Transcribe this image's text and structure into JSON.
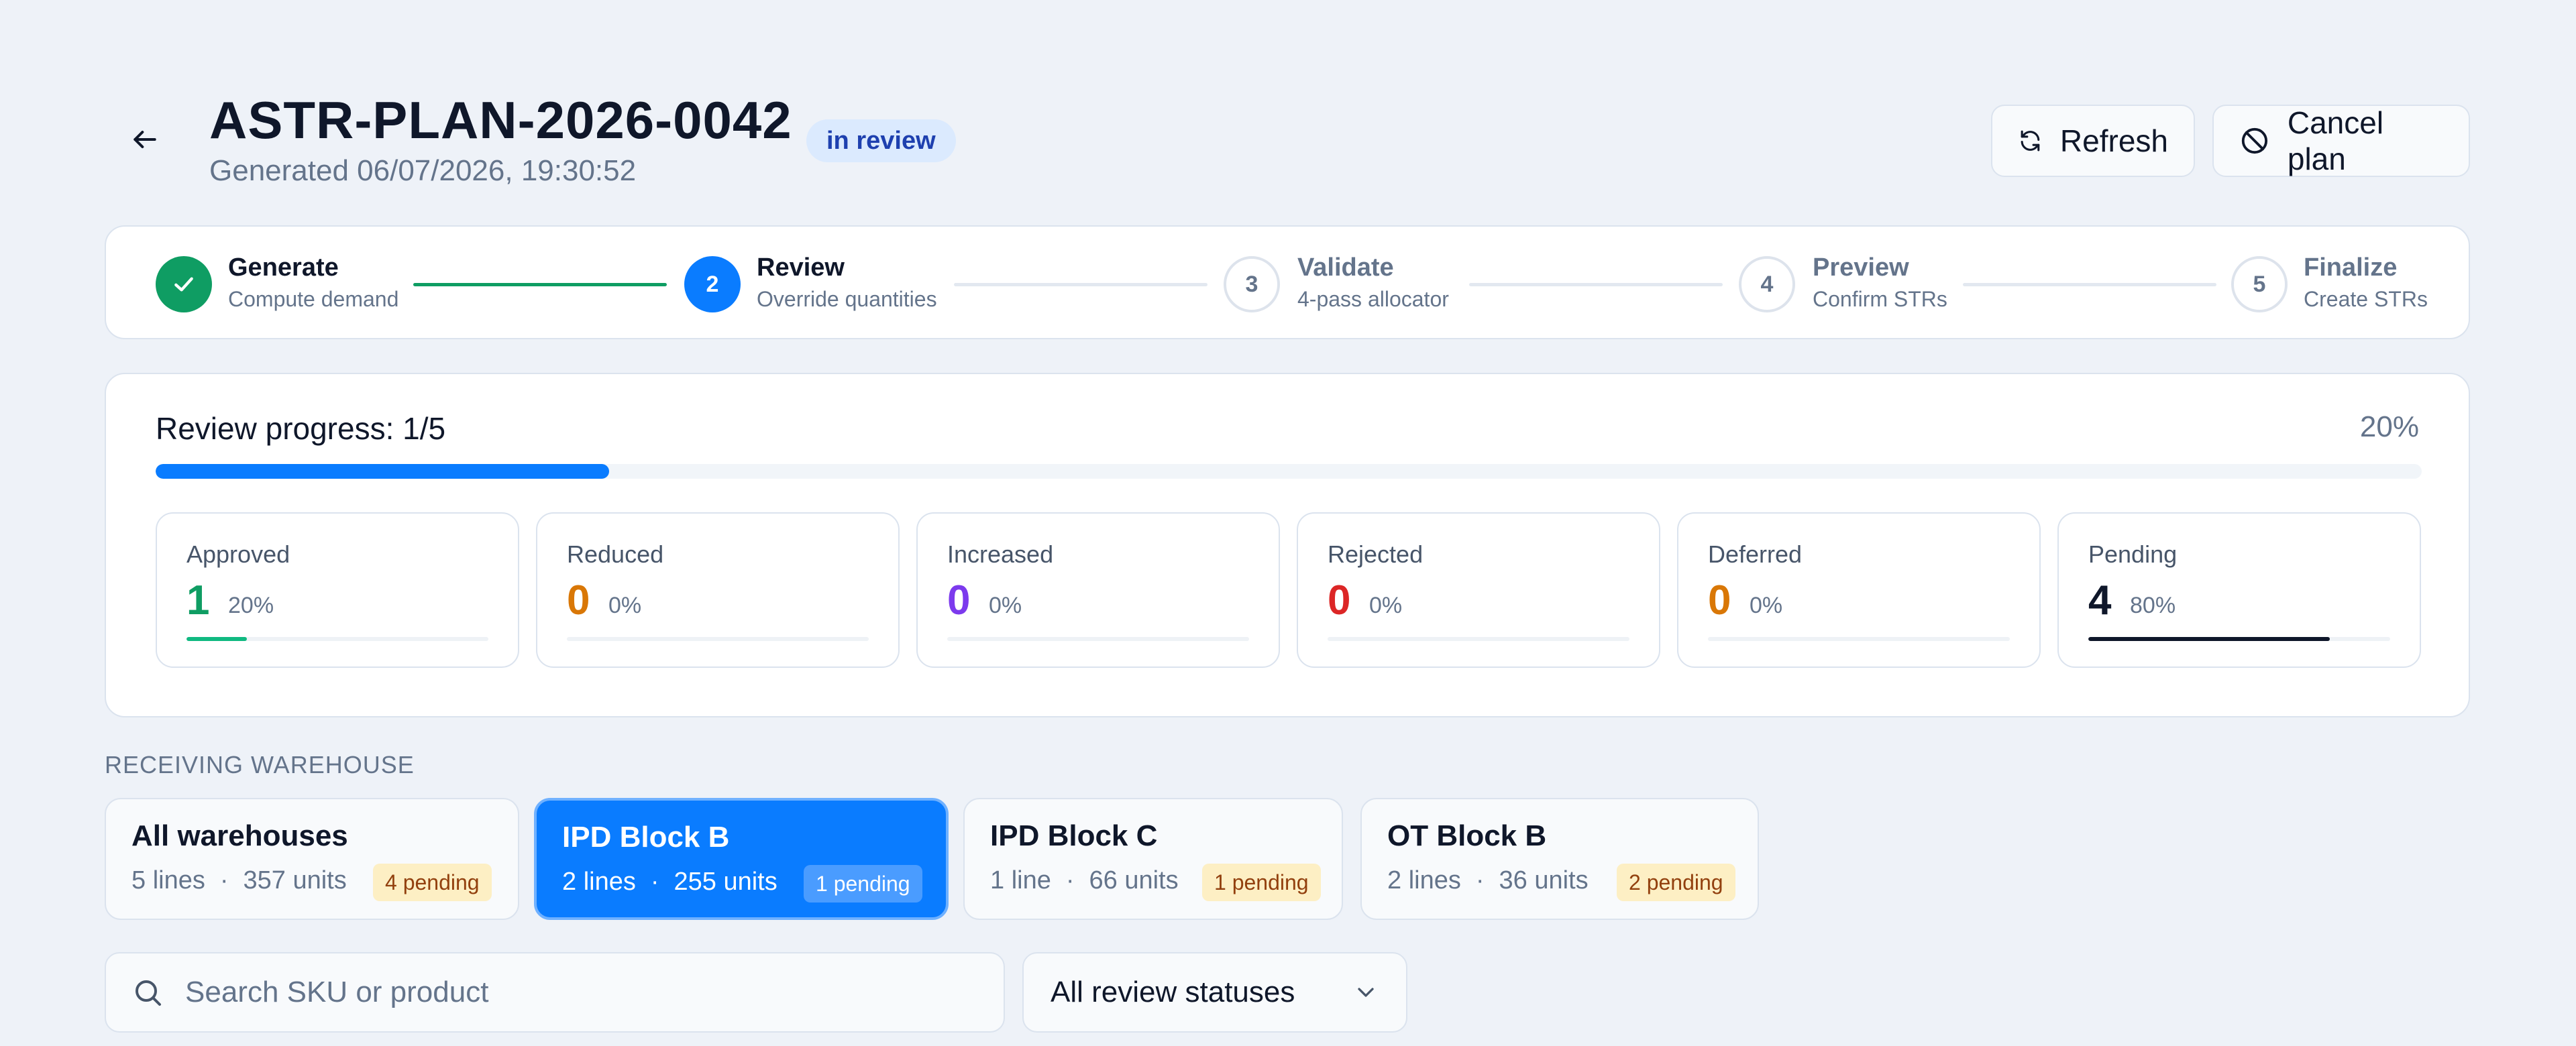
{
  "header": {
    "title": "ASTR-PLAN-2026-0042",
    "status": "in review",
    "subtitle": "Generated 06/07/2026, 19:30:52",
    "refresh_label": "Refresh",
    "cancel_label": "Cancel plan"
  },
  "stepper": {
    "steps": [
      {
        "number": "1",
        "label": "Generate",
        "sub": "Compute demand",
        "state": "done"
      },
      {
        "number": "2",
        "label": "Review",
        "sub": "Override quantities",
        "state": "active"
      },
      {
        "number": "3",
        "label": "Validate",
        "sub": "4-pass allocator",
        "state": "todo"
      },
      {
        "number": "4",
        "label": "Preview",
        "sub": "Confirm STRs",
        "state": "todo"
      },
      {
        "number": "5",
        "label": "Finalize",
        "sub": "Create STRs",
        "state": "todo"
      }
    ]
  },
  "progress": {
    "label": "Review progress: 1/5",
    "percent_text": "20%",
    "fraction": 0.2,
    "stats": [
      {
        "label": "Approved",
        "value": "1",
        "pct": "20%",
        "fraction": 0.2,
        "color": "#0f9d63",
        "bar": "#10b981"
      },
      {
        "label": "Reduced",
        "value": "0",
        "pct": "0%",
        "fraction": 0,
        "color": "#d97706",
        "bar": "#d97706"
      },
      {
        "label": "Increased",
        "value": "0",
        "pct": "0%",
        "fraction": 0,
        "color": "#7c3aed",
        "bar": "#7c3aed"
      },
      {
        "label": "Rejected",
        "value": "0",
        "pct": "0%",
        "fraction": 0,
        "color": "#dc2626",
        "bar": "#dc2626"
      },
      {
        "label": "Deferred",
        "value": "0",
        "pct": "0%",
        "fraction": 0,
        "color": "#d97706",
        "bar": "#d97706"
      },
      {
        "label": "Pending",
        "value": "4",
        "pct": "80%",
        "fraction": 0.8,
        "color": "#0f172a",
        "bar": "#0f172a"
      }
    ]
  },
  "warehouses": {
    "section_label": "RECEIVING WAREHOUSE",
    "items": [
      {
        "name": "All warehouses",
        "lines": "5 lines",
        "sep": "·",
        "units": "357 units",
        "pending": "4 pending",
        "selected": false
      },
      {
        "name": "IPD Block B",
        "lines": "2 lines",
        "sep": "·",
        "units": "255 units",
        "pending": "1 pending",
        "selected": true
      },
      {
        "name": "IPD Block C",
        "lines": "1 line",
        "sep": "·",
        "units": "66 units",
        "pending": "1 pending",
        "selected": false
      },
      {
        "name": "OT Block B",
        "lines": "2 lines",
        "sep": "·",
        "units": "36 units",
        "pending": "2 pending",
        "selected": false
      }
    ]
  },
  "filters": {
    "search_placeholder": "Search SKU or product",
    "status_select": "All review statuses"
  },
  "colors": {
    "accent": "#0a7cff",
    "success": "#0f9d63"
  }
}
